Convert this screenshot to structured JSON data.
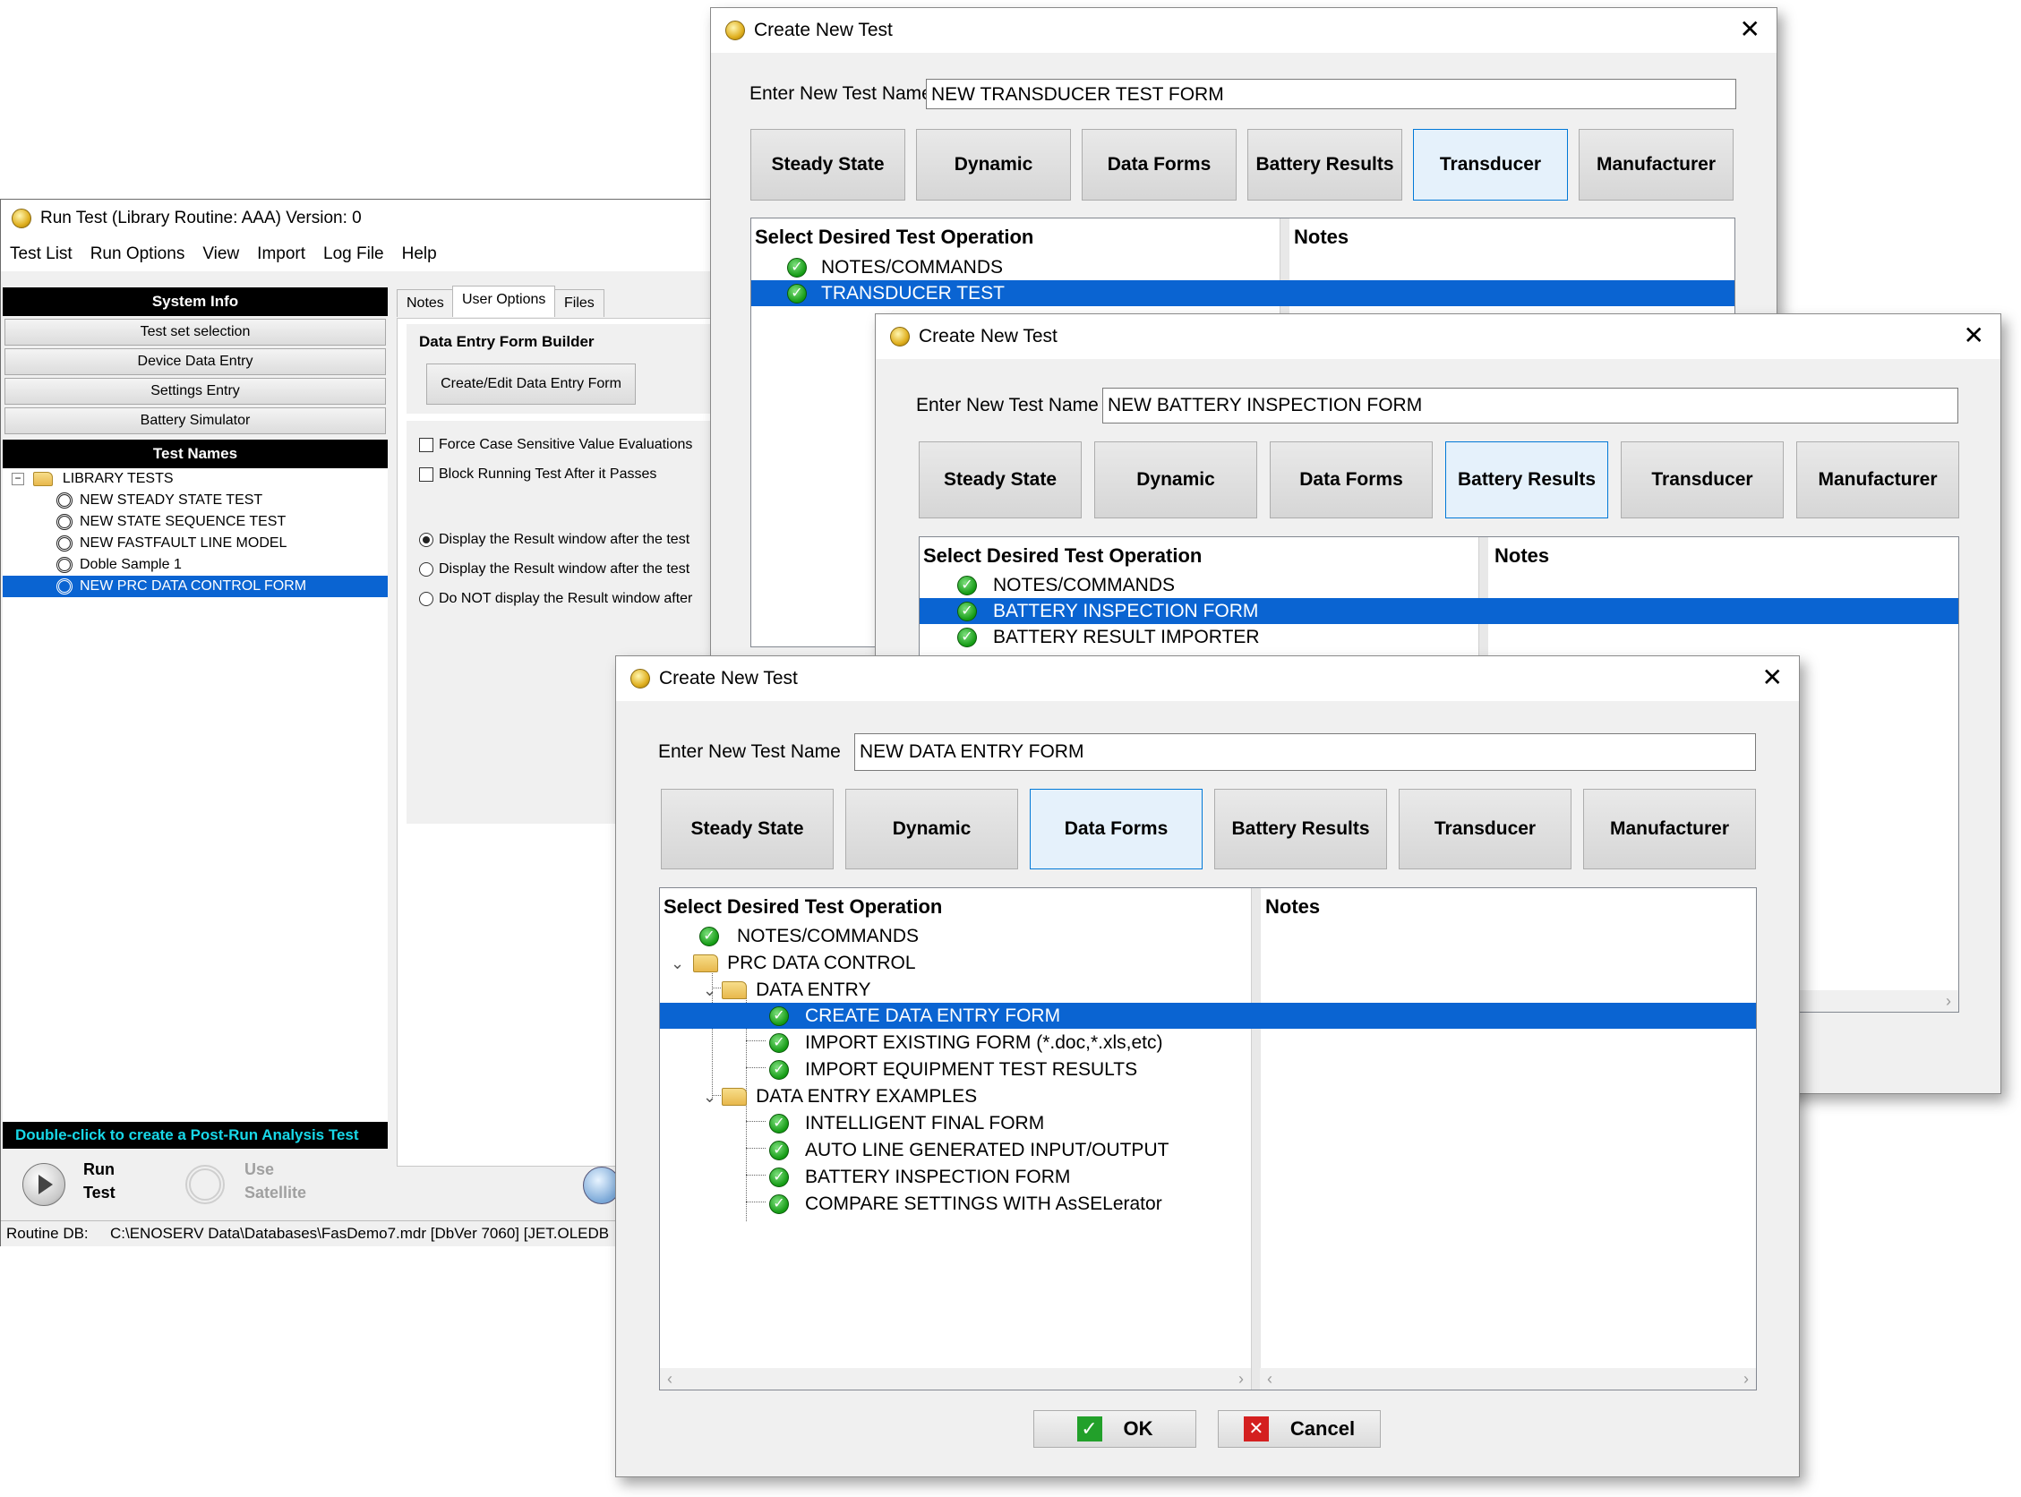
{
  "run_window": {
    "title": "Run Test (Library Routine: AAA)  Version: 0",
    "menu": [
      "Test List",
      "Run Options",
      "View",
      "Import",
      "Log File",
      "Help"
    ],
    "system_info_header": "System Info",
    "system_buttons": [
      "Test set selection",
      "Device Data Entry",
      "Settings Entry",
      "Battery Simulator"
    ],
    "test_names_header": "Test Names",
    "tree": {
      "root": "LIBRARY TESTS",
      "items": [
        "NEW STEADY STATE TEST",
        "NEW STATE SEQUENCE TEST",
        "NEW FASTFAULT LINE MODEL",
        "Doble Sample 1",
        "NEW PRC DATA CONTROL FORM"
      ],
      "selected": "NEW PRC DATA CONTROL FORM"
    },
    "tabs": [
      "Notes",
      "User Options",
      "Files"
    ],
    "active_tab": "User Options",
    "form_builder_label": "Data Entry Form Builder",
    "form_builder_button": "Create/Edit Data Entry Form",
    "checkboxes": [
      "Force Case Sensitive Value Evaluations",
      "Block Running Test After it Passes"
    ],
    "radios": [
      "Display the Result window after the test",
      "Display the Result window after the test",
      "Do NOT display the Result window after"
    ],
    "footer_hint": "Double-click to create a Post-Run Analysis Test",
    "run_label_1": "Run",
    "run_label_2": "Test",
    "satellite_label_1": "Use",
    "satellite_label_2": "Satellite",
    "status_label": "Routine DB:",
    "status_path": "C:\\ENOSERV Data\\Databases\\FasDemo7.mdr  [DbVer 7060] [JET.OLEDB"
  },
  "dialog_common": {
    "title": "Create New Test",
    "name_label": "Enter New Test Name",
    "categories": [
      "Steady State",
      "Dynamic",
      "Data Forms",
      "Battery Results",
      "Transducer",
      "Manufacturer"
    ],
    "col_operation": "Select Desired Test Operation",
    "col_notes": "Notes",
    "close": "✕"
  },
  "dialog_transducer": {
    "name_value": "NEW TRANSDUCER TEST FORM",
    "active_category": "Transducer",
    "items": [
      "NOTES/COMMANDS",
      "TRANSDUCER TEST"
    ],
    "selected": "TRANSDUCER TEST"
  },
  "dialog_battery": {
    "name_value": "NEW BATTERY INSPECTION FORM",
    "active_category": "Battery Results",
    "items": [
      "NOTES/COMMANDS",
      "BATTERY INSPECTION FORM",
      "BATTERY RESULT IMPORTER"
    ],
    "selected": "BATTERY INSPECTION FORM"
  },
  "dialog_dataforms": {
    "name_value": "NEW DATA ENTRY FORM",
    "active_category": "Data Forms",
    "tree": {
      "notes": "NOTES/COMMANDS",
      "prc": "PRC DATA CONTROL",
      "data_entry": "DATA ENTRY",
      "data_entry_items": [
        "CREATE DATA ENTRY FORM",
        "IMPORT EXISTING FORM (*.doc,*.xls,etc)",
        "IMPORT EQUIPMENT TEST RESULTS"
      ],
      "examples": "DATA ENTRY EXAMPLES",
      "example_items": [
        "INTELLIGENT FINAL FORM",
        "AUTO LINE GENERATED INPUT/OUTPUT",
        "BATTERY INSPECTION FORM",
        "COMPARE SETTINGS WITH AsSELerator"
      ]
    },
    "selected": "CREATE DATA ENTRY FORM",
    "ok": "OK",
    "cancel": "Cancel"
  }
}
